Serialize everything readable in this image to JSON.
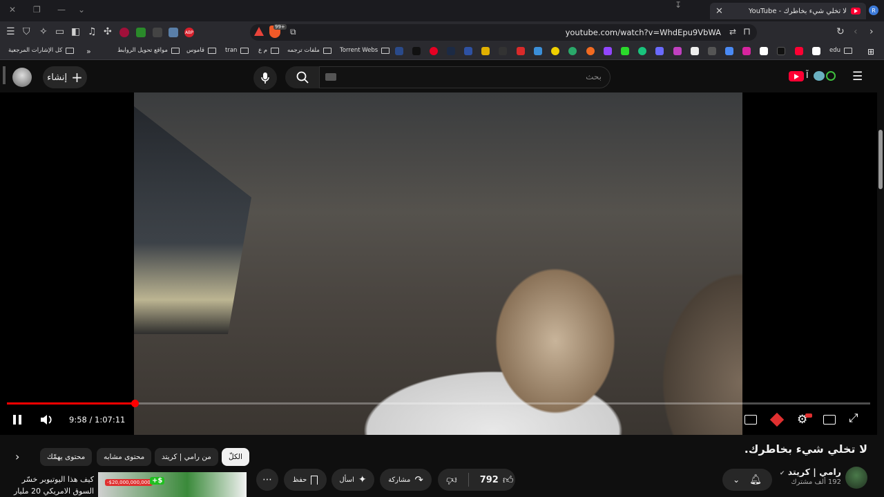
{
  "browser": {
    "tab_title": "لا تخلي شيء بخاطرك - YouTube",
    "profile_initial": "R",
    "url": "youtube.com/watch?v=WhdEpu9VbWA",
    "ext_badge": "99+",
    "abp_label": "ABP",
    "bookmarks": [
      {
        "label": "كل الإشارات المرجعية",
        "type": "folder"
      },
      {
        "label": "مواقع تحويل الروابط",
        "type": "folder"
      },
      {
        "label": "قاموس",
        "type": "folder"
      },
      {
        "label": "tran",
        "type": "folder"
      },
      {
        "label": "م ع",
        "type": "folder"
      },
      {
        "label": "ملفات ترجمه",
        "type": "folder"
      },
      {
        "label": "Torrent Webs",
        "type": "folder"
      },
      {
        "label": "edu",
        "type": "folder"
      }
    ],
    "bookmark_overflow": "»"
  },
  "youtube": {
    "create_label": "إنشاء",
    "search_placeholder": "بحث",
    "logo_colors": {
      "red": "#ff0033",
      "text": "#f1f1f1"
    }
  },
  "player": {
    "time_display": "9:58 / 1:07:11",
    "progress_fraction": 0.1483
  },
  "video": {
    "title": "لا تخلي شيء بخاطرك.",
    "channel_name": "رامي | كريتد",
    "subscribers": "192 ألف مشترك",
    "like_count": "792",
    "share_label": "مشاركة",
    "ask_label": "اسأل",
    "save_label": "حفظ",
    "more_icon": "⋯"
  },
  "chips": [
    "الكلّ",
    "من رامي | كريتد",
    "محتوى مشابه",
    "محتوى يهمّك"
  ],
  "next_video": {
    "title_line1": "كيف هذا اليوتيوبر خسّر",
    "title_line2": "السوق الامريكي 20 مليار",
    "thumb_text_red": "-$20,000,000,000",
    "thumb_text_green": "+$"
  },
  "colors": {
    "brand_red": "#ff0033",
    "progress": "#ff0000",
    "background": "#0f0f0f"
  }
}
